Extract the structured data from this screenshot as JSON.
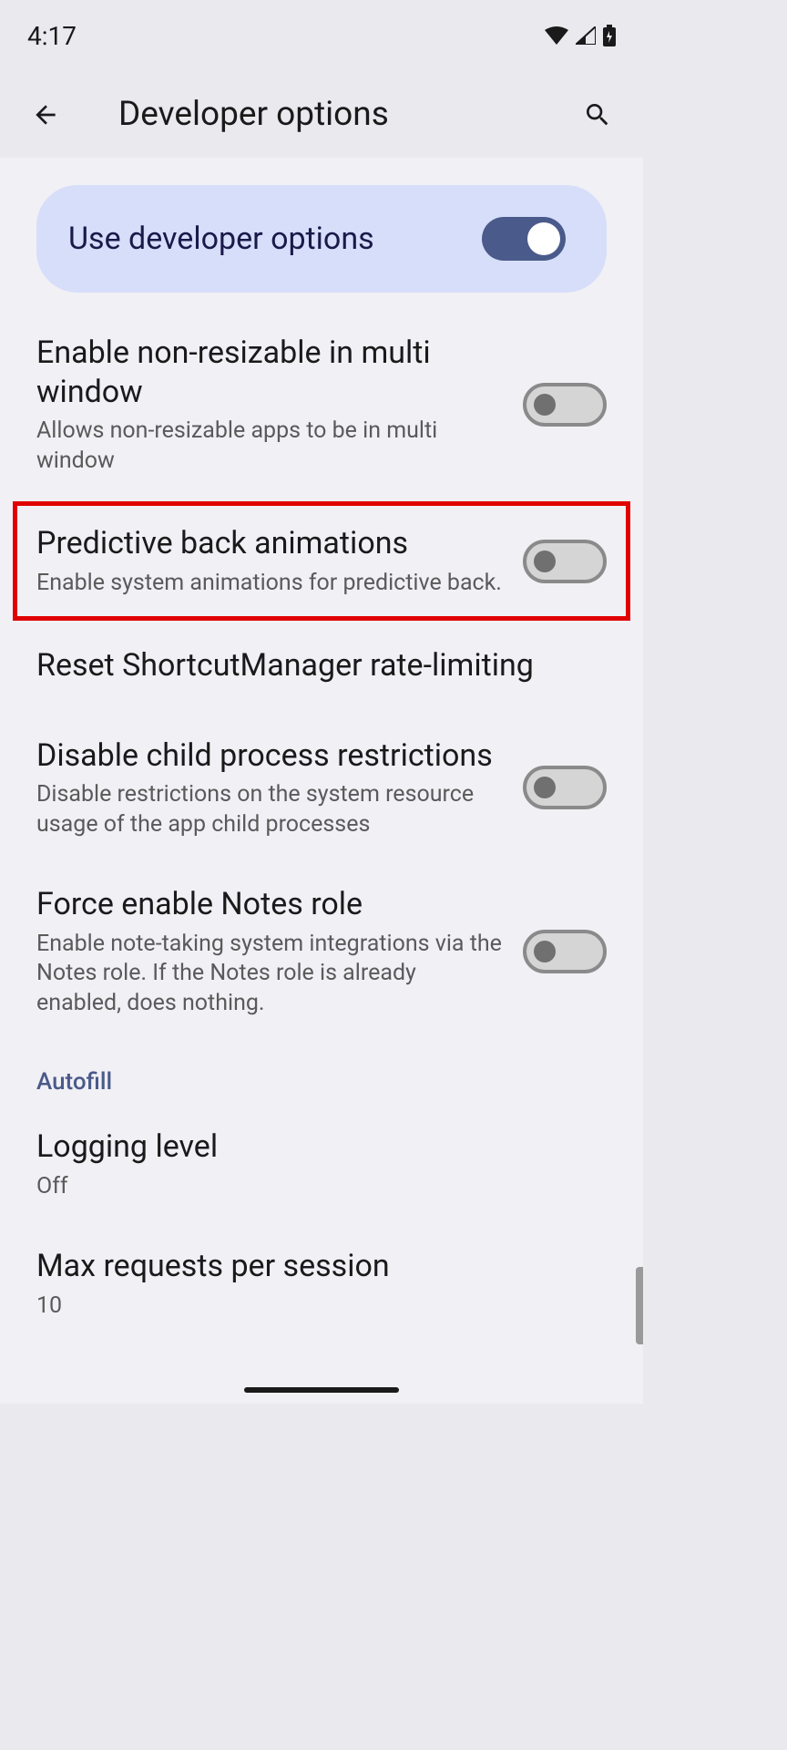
{
  "status": {
    "time": "4:17"
  },
  "header": {
    "title": "Developer options"
  },
  "devOptionsCard": {
    "label": "Use developer options"
  },
  "settings": [
    {
      "title": "Enable non-resizable in multi window",
      "subtitle": "Allows non-resizable apps to be in multi window",
      "toggle": false
    },
    {
      "title": "Predictive back animations",
      "subtitle": "Enable system animations for predictive back.",
      "toggle": false,
      "highlighted": true
    },
    {
      "title": "Reset ShortcutManager rate-limiting",
      "subtitle": null,
      "toggle": null
    },
    {
      "title": "Disable child process restrictions",
      "subtitle": "Disable restrictions on the system resource usage of the app child processes",
      "toggle": false
    },
    {
      "title": "Force enable Notes role",
      "subtitle": "Enable note-taking system integrations via the Notes role. If the Notes role is already enabled, does nothing.",
      "toggle": false
    }
  ],
  "autofill": {
    "header": "Autofill",
    "items": [
      {
        "title": "Logging level",
        "subtitle": "Off"
      },
      {
        "title": "Max requests per session",
        "subtitle": "10"
      }
    ]
  }
}
